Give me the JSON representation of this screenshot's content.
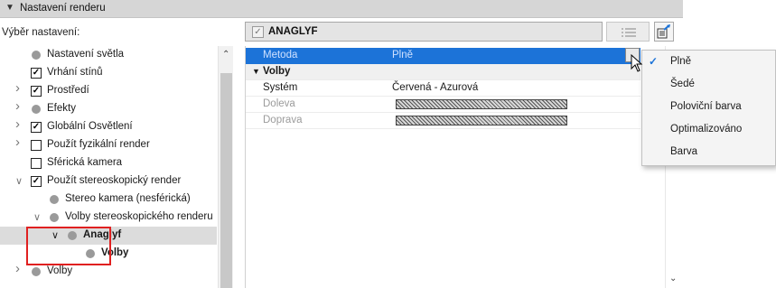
{
  "panel": {
    "title": "Nastavení renderu"
  },
  "preset": {
    "label": "Výběr nastavení:",
    "name": "ANAGLYF"
  },
  "tree": {
    "items": [
      {
        "label": "Nastavení světla",
        "control": "dot",
        "expander": "none",
        "indent": 0
      },
      {
        "label": "Vrhání stínů",
        "control": "checkbox",
        "checked": true,
        "expander": "none",
        "indent": 0
      },
      {
        "label": "Prostředí",
        "control": "checkbox",
        "checked": true,
        "expander": "collapsed",
        "indent": 0
      },
      {
        "label": "Efekty",
        "control": "dot",
        "expander": "collapsed",
        "indent": 0
      },
      {
        "label": "Globální Osvětlení",
        "control": "checkbox",
        "checked": true,
        "expander": "collapsed",
        "indent": 0
      },
      {
        "label": "Použít fyzikální render",
        "control": "checkbox",
        "checked": false,
        "expander": "collapsed",
        "indent": 0
      },
      {
        "label": "Sférická kamera",
        "control": "checkbox",
        "checked": false,
        "expander": "none",
        "indent": 0
      },
      {
        "label": "Použít stereoskopický render",
        "control": "checkbox",
        "checked": true,
        "expander": "expanded",
        "indent": 0
      },
      {
        "label": "Stereo kamera (nesférická)",
        "control": "dot",
        "expander": "none",
        "indent": 1
      },
      {
        "label": "Volby stereoskopického renderu",
        "control": "dot",
        "expander": "expanded",
        "indent": 1
      },
      {
        "label": "Anaglyf",
        "control": "dot",
        "expander": "expanded",
        "indent": 2,
        "selected": true,
        "bold": true
      },
      {
        "label": "Volby",
        "control": "dot",
        "expander": "none",
        "indent": 3,
        "bold": true
      },
      {
        "label": "Volby",
        "control": "dot",
        "expander": "collapsed",
        "indent": 0
      }
    ]
  },
  "props": {
    "metoda": {
      "key": "Metoda",
      "value": "Plně"
    },
    "section": {
      "label": "Volby"
    },
    "system": {
      "key": "Systém",
      "value": "Červená - Azurová"
    },
    "doleva": {
      "key": "Doleva"
    },
    "doprava": {
      "key": "Doprava"
    }
  },
  "dropdown": {
    "selected": "Plně",
    "options": [
      "Plně",
      "Šedé",
      "Poloviční barva",
      "Optimalizováno",
      "Barva"
    ]
  },
  "colors": {
    "accent": "#1c73d8",
    "highlight": "#e02020",
    "selection": "#dcdcdc"
  }
}
